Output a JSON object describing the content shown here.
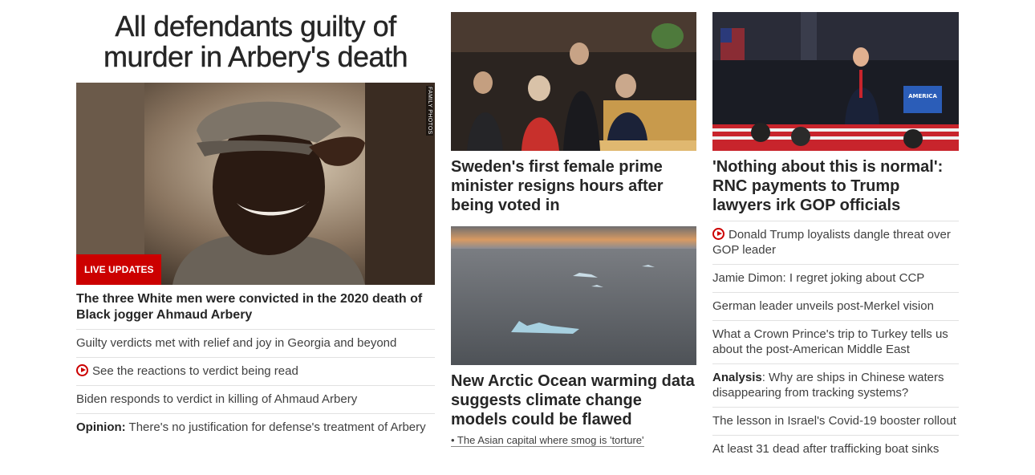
{
  "left": {
    "hero_title": "All defendants guilty of murder in Arbery's death",
    "image_credit": "FAMILY PHOTOS",
    "badge": "LIVE UPDATES",
    "lead_headline": "The three White men were convicted in the 2020 death of Black jogger Ahmaud Arbery",
    "items": [
      {
        "text": "Guilty verdicts met with relief and joy in Georgia and beyond"
      },
      {
        "text": "See the reactions to verdict being read",
        "icon": "play-video-icon"
      },
      {
        "text": "Biden responds to verdict in killing of Ahmaud Arbery"
      },
      {
        "prefix": "Opinion:",
        "text": " There's no justification for defense's treatment of Arbery"
      }
    ]
  },
  "middle": {
    "card1_headline": "Sweden's first female prime minister resigns hours after being voted in",
    "card2_headline": "New Arctic Ocean warming data suggests climate change models could be flawed",
    "card2_sublink": "• The Asian capital where smog is 'torture'"
  },
  "right": {
    "card_headline": "'Nothing about this is normal': RNC payments to Trump lawyers irk GOP officials",
    "sign_text": "AMERICA",
    "items": [
      {
        "text": "Donald Trump loyalists dangle threat over GOP leader",
        "icon": "play-video-icon"
      },
      {
        "text": "Jamie Dimon: I regret joking about CCP"
      },
      {
        "text": "German leader unveils post-Merkel vision"
      },
      {
        "text": "What a Crown Prince's trip to Turkey tells us about the post-American Middle East"
      },
      {
        "prefix": "Analysis",
        "text": ": Why are ships in Chinese waters disappearing from tracking systems?"
      },
      {
        "text": "The lesson in Israel's Covid-19 booster rollout"
      },
      {
        "text": "At least 31 dead after trafficking boat sinks"
      }
    ]
  }
}
